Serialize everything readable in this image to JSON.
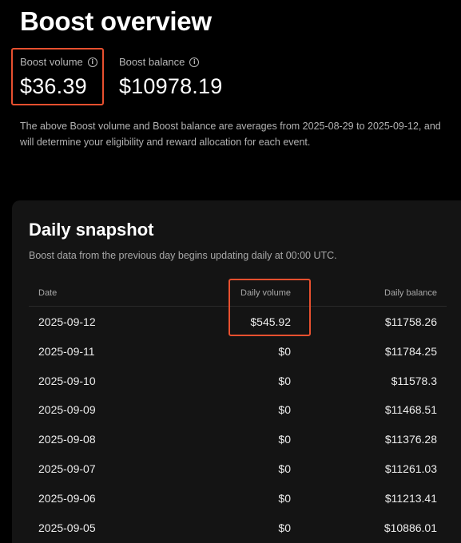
{
  "header": {
    "title": "Boost overview"
  },
  "stats": {
    "volume": {
      "label": "Boost volume",
      "value": "$36.39"
    },
    "balance": {
      "label": "Boost balance",
      "value": "$10978.19"
    }
  },
  "note": "The above Boost volume and Boost balance are averages from 2025-08-29 to 2025-09-12, and will determine your eligibility and reward allocation for each event.",
  "snapshot": {
    "title": "Daily snapshot",
    "subtitle": "Boost data from the previous day begins updating daily at 00:00 UTC.",
    "columns": {
      "date": "Date",
      "volume": "Daily volume",
      "balance": "Daily balance"
    },
    "rows": [
      {
        "date": "2025-09-12",
        "volume": "$545.92",
        "balance": "$11758.26"
      },
      {
        "date": "2025-09-11",
        "volume": "$0",
        "balance": "$11784.25"
      },
      {
        "date": "2025-09-10",
        "volume": "$0",
        "balance": "$11578.3"
      },
      {
        "date": "2025-09-09",
        "volume": "$0",
        "balance": "$11468.51"
      },
      {
        "date": "2025-09-08",
        "volume": "$0",
        "balance": "$11376.28"
      },
      {
        "date": "2025-09-07",
        "volume": "$0",
        "balance": "$11261.03"
      },
      {
        "date": "2025-09-06",
        "volume": "$0",
        "balance": "$11213.41"
      },
      {
        "date": "2025-09-05",
        "volume": "$0",
        "balance": "$10886.01"
      }
    ]
  },
  "colors": {
    "background": "#000000",
    "card": "#141414",
    "highlight": "#e8502f"
  },
  "icons": {
    "info": "info-icon"
  }
}
